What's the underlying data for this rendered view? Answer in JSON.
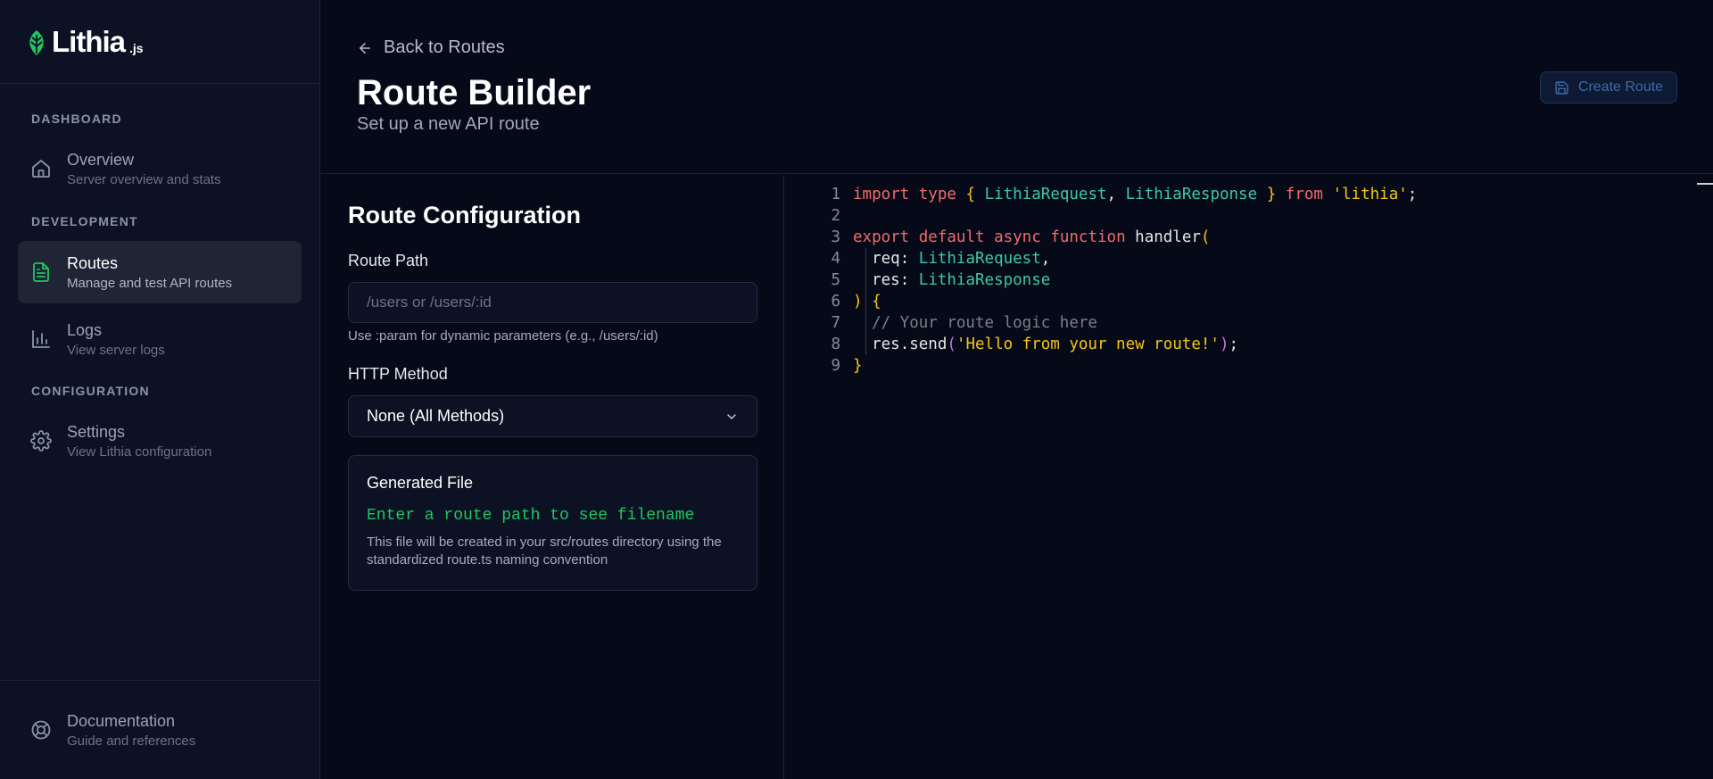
{
  "brand": {
    "name": "Lithia",
    "suffix": ".js",
    "accent": "#22c55e"
  },
  "sidebar": {
    "sections": [
      {
        "label": "DASHBOARD"
      },
      {
        "label": "DEVELOPMENT"
      },
      {
        "label": "CONFIGURATION"
      }
    ],
    "items": [
      {
        "title": "Overview",
        "subtitle": "Server overview and stats",
        "icon": "home-icon",
        "active": false
      },
      {
        "title": "Routes",
        "subtitle": "Manage and test API routes",
        "icon": "file-text-icon",
        "active": true
      },
      {
        "title": "Logs",
        "subtitle": "View server logs",
        "icon": "bar-chart-icon",
        "active": false
      },
      {
        "title": "Settings",
        "subtitle": "View Lithia configuration",
        "icon": "gear-icon",
        "active": false
      }
    ],
    "footer": {
      "title": "Documentation",
      "subtitle": "Guide and references",
      "icon": "lifebuoy-icon"
    }
  },
  "header": {
    "back_label": "Back to Routes",
    "title": "Route Builder",
    "subtitle": "Set up a new API route",
    "create_button": "Create Route"
  },
  "config": {
    "title": "Route Configuration",
    "route_path_label": "Route Path",
    "route_path_placeholder": "/users or /users/:id",
    "route_path_value": "",
    "route_path_hint": "Use :param for dynamic parameters (e.g., /users/:id)",
    "method_label": "HTTP Method",
    "method_value": "None (All Methods)",
    "generated": {
      "title": "Generated File",
      "path": "Enter a route path to see filename",
      "description": "This file will be created in your src/routes directory using the standardized route.ts naming convention"
    }
  },
  "editor": {
    "line_numbers": [
      "1",
      "2",
      "3",
      "4",
      "5",
      "6",
      "7",
      "8",
      "9"
    ],
    "tokens": {
      "l1": [
        "import",
        "type",
        "{",
        "LithiaRequest",
        ",",
        "LithiaResponse",
        "}",
        "from",
        "'lithia'",
        ";"
      ],
      "l3": [
        "export",
        "default",
        "async",
        "function",
        "handler",
        "("
      ],
      "l4": [
        "req",
        ":",
        "LithiaRequest",
        ","
      ],
      "l5": [
        "res",
        ":",
        "LithiaResponse"
      ],
      "l6": [
        ")",
        "{"
      ],
      "l7": [
        "// Your route logic here"
      ],
      "l8": [
        "res",
        ".send",
        "(",
        "'Hello from your new route!'",
        ")",
        ";"
      ],
      "l9": [
        "}"
      ]
    }
  }
}
